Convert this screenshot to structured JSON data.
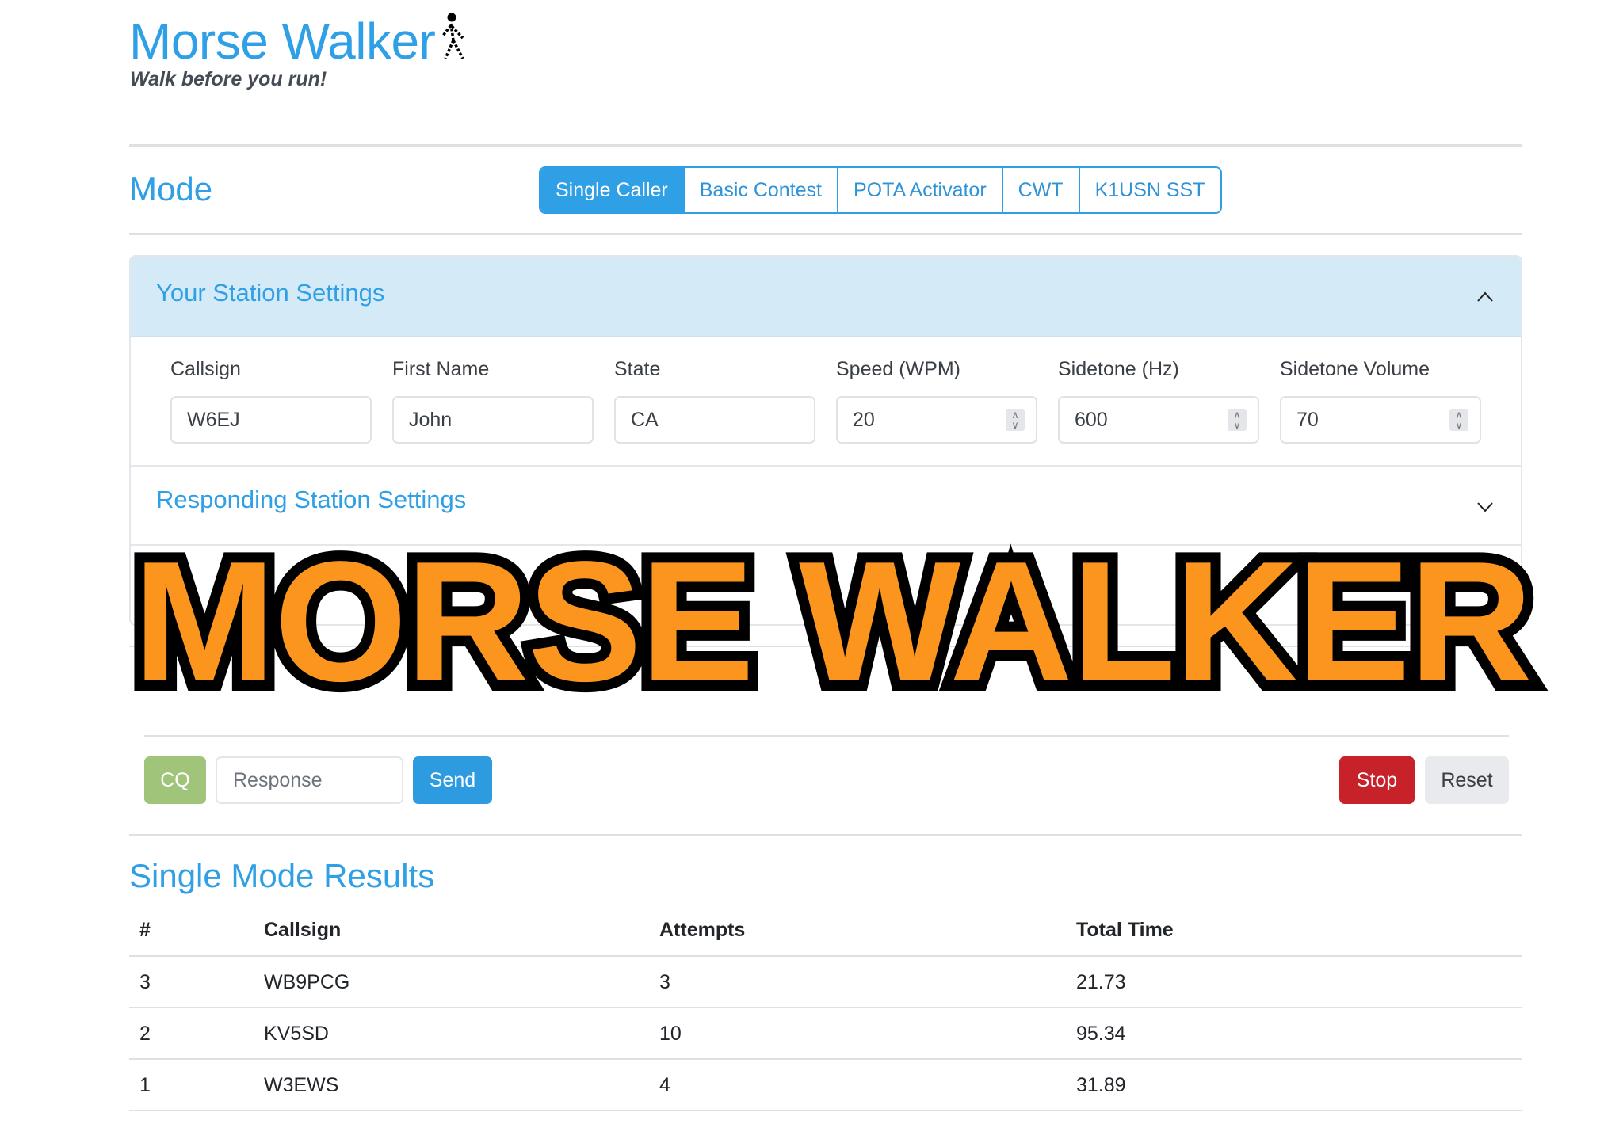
{
  "header": {
    "title": "Morse Walker",
    "tagline": "Walk before you run!",
    "logo_icon": "walking-person-icon"
  },
  "mode": {
    "title": "Mode",
    "options": [
      {
        "label": "Single Caller",
        "active": true
      },
      {
        "label": "Basic Contest",
        "active": false
      },
      {
        "label": "POTA Activator",
        "active": false
      },
      {
        "label": "CWT",
        "active": false
      },
      {
        "label": "K1USN SST",
        "active": false
      }
    ]
  },
  "your_station": {
    "title": "Your Station Settings",
    "expanded": true,
    "fields": [
      {
        "label": "Callsign",
        "value": "W6EJ"
      },
      {
        "label": "First Name",
        "value": "John"
      },
      {
        "label": "State",
        "value": "CA"
      },
      {
        "label": "Speed (WPM)",
        "value": "20"
      },
      {
        "label": "Sidetone (Hz)",
        "value": "600"
      },
      {
        "label": "Sidetone Volume",
        "value": "70"
      }
    ]
  },
  "responding_station": {
    "title": "Responding Station Settings",
    "expanded": false
  },
  "overlay": {
    "text": "MORSE WALKER"
  },
  "controls": {
    "cq_label": "CQ",
    "response_placeholder": "Response",
    "send_label": "Send",
    "stop_label": "Stop",
    "reset_label": "Reset"
  },
  "results": {
    "title": "Single Mode Results",
    "columns": [
      "#",
      "Callsign",
      "Attempts",
      "Total Time"
    ],
    "rows": [
      [
        "3",
        "WB9PCG",
        "3",
        "21.73"
      ],
      [
        "2",
        "KV5SD",
        "10",
        "95.34"
      ],
      [
        "1",
        "W3EWS",
        "4",
        "31.89"
      ]
    ]
  },
  "colors": {
    "brand_blue": "#2fa0e6",
    "accordion_header_bg": "#d5eaf7",
    "cq_green": "#9fc47a",
    "stop_red": "#c7212a",
    "overlay_orange": "#fb951e"
  }
}
